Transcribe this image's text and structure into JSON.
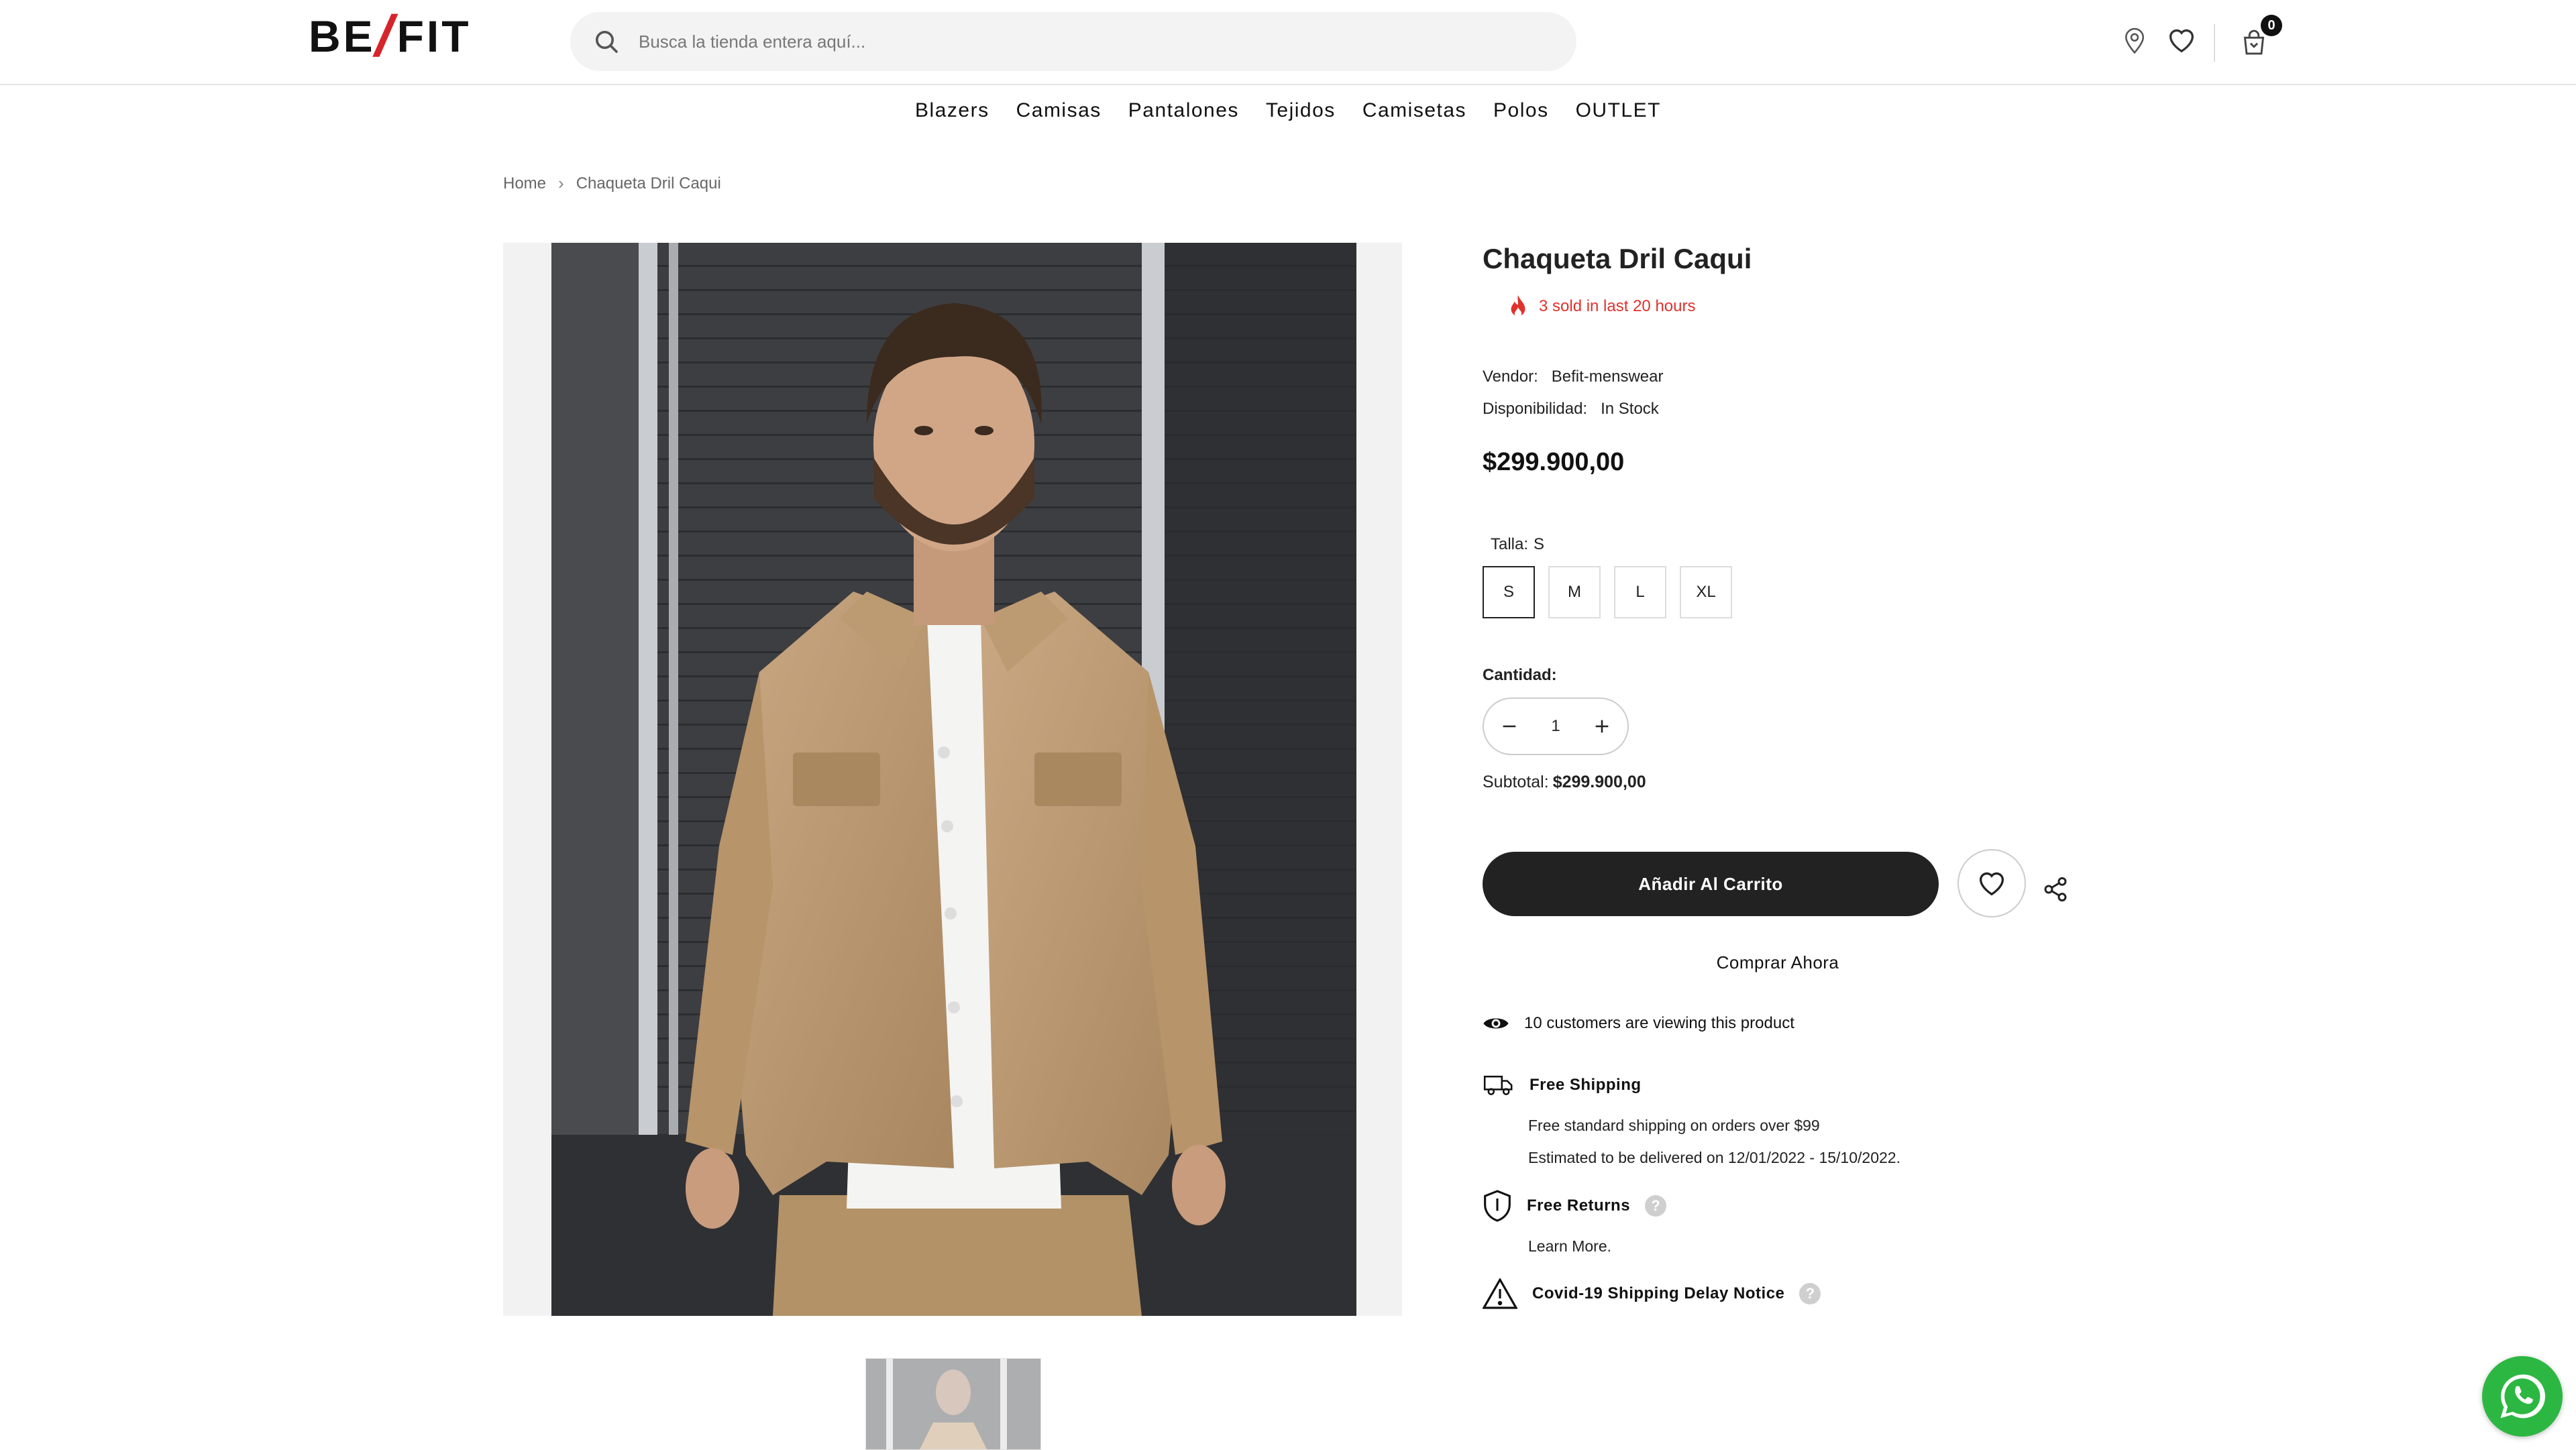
{
  "header": {
    "logo_left": "BE",
    "logo_slash": "/",
    "logo_right": "FIT",
    "search_placeholder": "Busca la tienda entera aquí...",
    "cart_count": "0",
    "icons": [
      "search-icon",
      "location-icon",
      "heart-icon",
      "cart-icon"
    ]
  },
  "nav": {
    "items": [
      "Blazers",
      "Camisas",
      "Pantalones",
      "Tejidos",
      "Camisetas",
      "Polos",
      "OUTLET"
    ]
  },
  "breadcrumb": {
    "home": "Home",
    "current": "Chaqueta Dril Caqui"
  },
  "product": {
    "title": "Chaqueta Dril Caqui",
    "sold_notice": "3 sold in last 20 hours",
    "vendor_label": "Vendor:",
    "vendor_value": "Befit-menswear",
    "availability_label": "Disponibilidad:",
    "availability_value": "In Stock",
    "price": "$299.900,00",
    "size_label": "Talla:",
    "size_selected": "S",
    "sizes": [
      "S",
      "M",
      "L",
      "XL"
    ],
    "quantity_label": "Cantidad:",
    "quantity": "1",
    "subtotal_label": "Subtotal:",
    "subtotal_value": "$299.900,00",
    "add_to_cart": "Añadir Al Carrito",
    "buy_now": "Comprar Ahora"
  },
  "info": {
    "viewers": "10 customers are viewing this product",
    "shipping_title": "Free Shipping",
    "shipping_line1": "Free standard shipping on orders over $99",
    "shipping_line2": "Estimated to be delivered on 12/01/2022 - 15/10/2022.",
    "returns_title": "Free Returns",
    "returns_link": "Learn More.",
    "covid_title": "Covid-19 Shipping Delay Notice",
    "help_glyph": "?"
  },
  "colors": {
    "accent_red": "#e0312c",
    "button_dark": "#222222",
    "whatsapp_green": "#2cb742"
  }
}
